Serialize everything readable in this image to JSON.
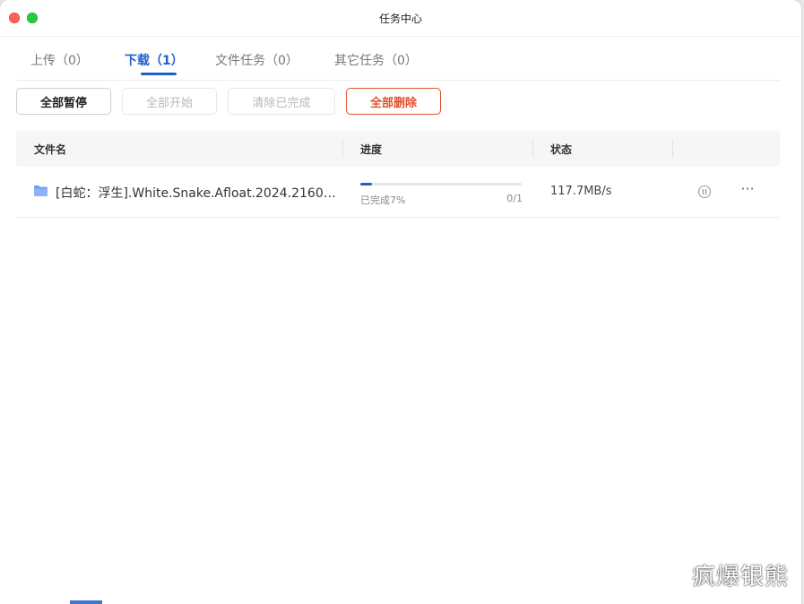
{
  "window": {
    "title": "任务中心"
  },
  "tabs": [
    {
      "label": "上传（0）",
      "active": false
    },
    {
      "label": "下载（1）",
      "active": true
    },
    {
      "label": "文件任务（0）",
      "active": false
    },
    {
      "label": "其它任务（0）",
      "active": false
    }
  ],
  "toolbar": {
    "pause_all": "全部暂停",
    "start_all": "全部开始",
    "clear_done": "清除已完成",
    "delete_all": "全部删除"
  },
  "table": {
    "headers": {
      "name": "文件名",
      "progress": "进度",
      "status": "状态"
    },
    "rows": [
      {
        "icon": "folder-icon",
        "name": "[白蛇：浮生].White.Snake.Afloat.2024.2160p.6...",
        "progress_percent": 7,
        "progress_text": "已完成7%",
        "count": "0/1",
        "speed": "117.7MB/s"
      }
    ]
  },
  "watermark": "疯爆银熊",
  "colors": {
    "accent": "#1f5fd1",
    "danger": "#e0512e"
  }
}
